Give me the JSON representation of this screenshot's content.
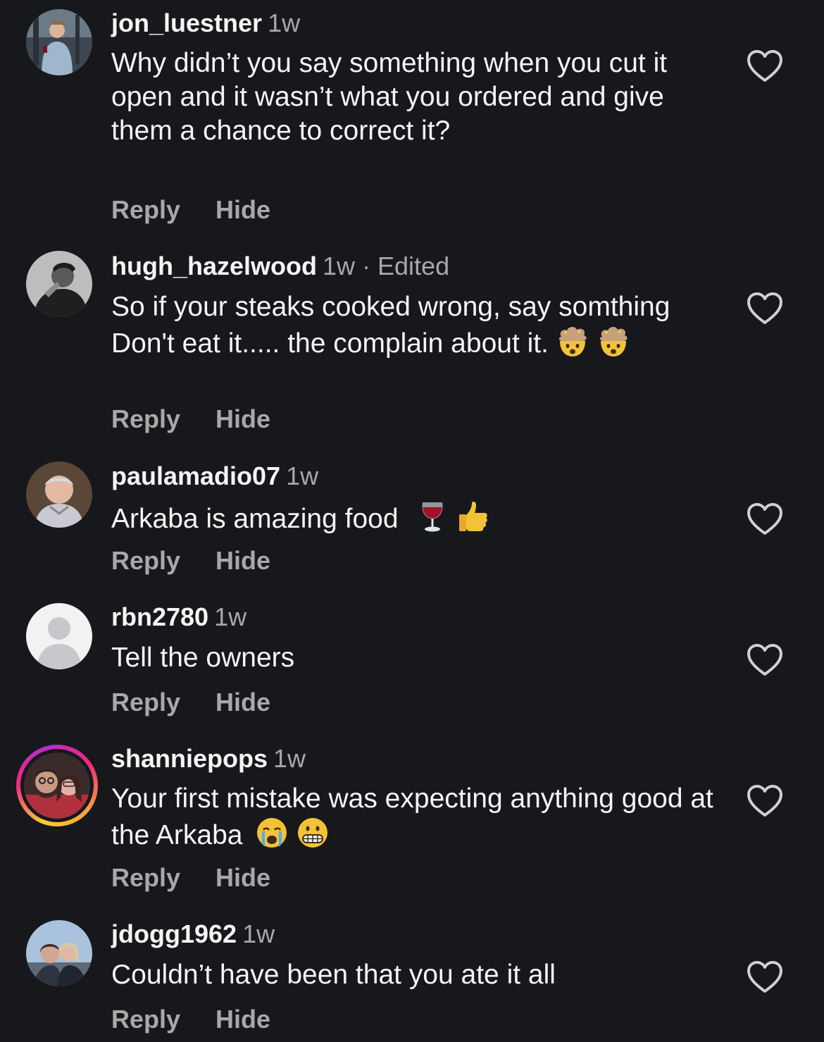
{
  "comments": [
    {
      "username": "jon_luestner",
      "meta": "1w",
      "text": "Why didn’t you say something when you cut it open and it wasn’t what you ordered and give them a chance to correct it?",
      "reply_label": "Reply",
      "hide_label": "Hide"
    },
    {
      "username": "hugh_hazelwood",
      "meta": "1w · Edited",
      "text": "So if your steaks cooked wrong, say somthing Don't eat it..... the complain about it.",
      "emojis": [
        "exploding-head-emoji",
        "exploding-head-emoji"
      ],
      "reply_label": "Reply",
      "hide_label": "Hide"
    },
    {
      "username": "paulamadio07",
      "meta": "1w",
      "text": "Arkaba is amazing food",
      "emojis": [
        "wine-glass-emoji",
        "thumbs-up-emoji"
      ],
      "reply_label": "Reply",
      "hide_label": "Hide"
    },
    {
      "username": "rbn2780",
      "meta": "1w",
      "text": "Tell the owners",
      "reply_label": "Reply",
      "hide_label": "Hide"
    },
    {
      "username": "shanniepops",
      "meta": "1w",
      "text": "Your first mistake was expecting anything good at the Arkaba",
      "emojis": [
        "crying-face-emoji",
        "grimacing-face-emoji"
      ],
      "reply_label": "Reply",
      "hide_label": "Hide"
    },
    {
      "username": "jdogg1962",
      "meta": "1w",
      "text": "Couldn’t have been that you ate it all",
      "reply_label": "Reply",
      "hide_label": "Hide"
    }
  ],
  "colors": {
    "background": "#16181c",
    "primary_text": "#f5f5f5",
    "secondary_text": "#a8a8a8",
    "heart_outline": "#d0d0d0"
  },
  "icons": {
    "like": "heart-outline-icon"
  }
}
